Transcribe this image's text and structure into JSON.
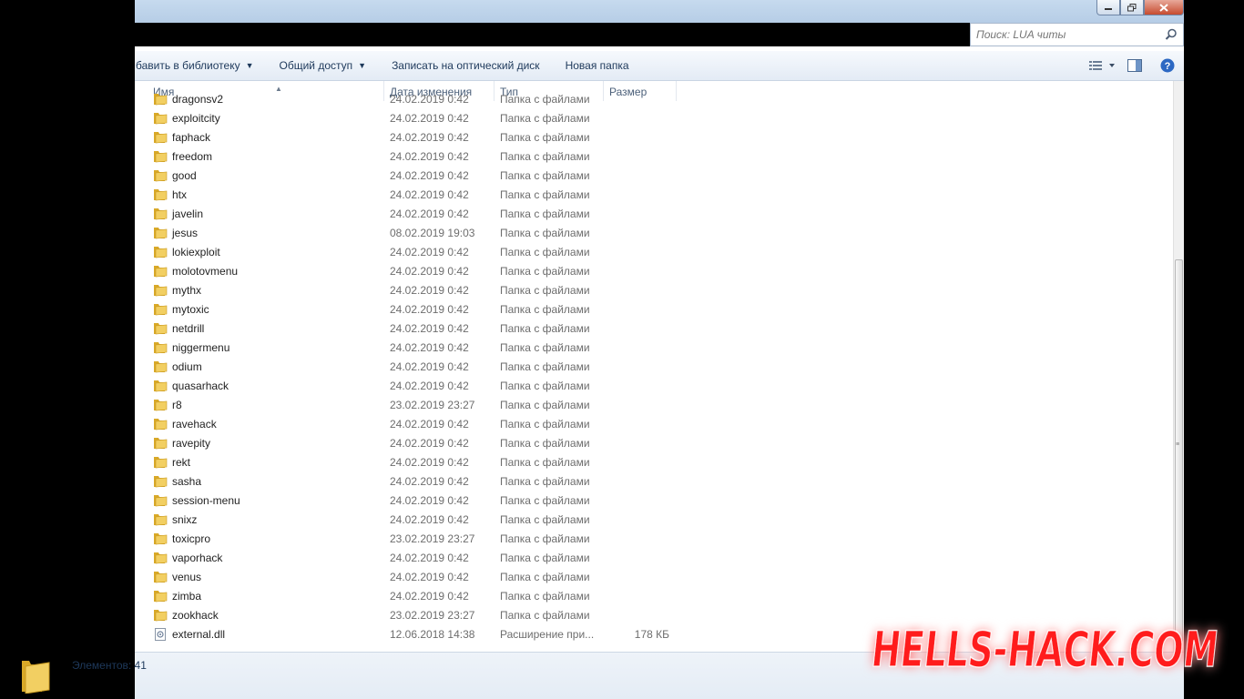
{
  "search": {
    "placeholder": "Поиск: LUA читы"
  },
  "toolbar": {
    "add_library": "бавить в библиотеку",
    "share": "Общий доступ",
    "burn": "Записать на оптический диск",
    "new_folder": "Новая папка"
  },
  "columns": {
    "name": "Имя",
    "date": "Дата изменения",
    "type": "Тип",
    "size": "Размер"
  },
  "files": [
    {
      "name": "dragonsv2",
      "date": "24.02.2019 0:42",
      "type": "Папка с файлами",
      "size": "",
      "icon": "folder-icon"
    },
    {
      "name": "exploitcity",
      "date": "24.02.2019 0:42",
      "type": "Папка с файлами",
      "size": "",
      "icon": "folder-icon"
    },
    {
      "name": "faphack",
      "date": "24.02.2019 0:42",
      "type": "Папка с файлами",
      "size": "",
      "icon": "folder-icon"
    },
    {
      "name": "freedom",
      "date": "24.02.2019 0:42",
      "type": "Папка с файлами",
      "size": "",
      "icon": "folder-icon"
    },
    {
      "name": "good",
      "date": "24.02.2019 0:42",
      "type": "Папка с файлами",
      "size": "",
      "icon": "folder-icon"
    },
    {
      "name": "htx",
      "date": "24.02.2019 0:42",
      "type": "Папка с файлами",
      "size": "",
      "icon": "folder-icon"
    },
    {
      "name": "javelin",
      "date": "24.02.2019 0:42",
      "type": "Папка с файлами",
      "size": "",
      "icon": "folder-icon"
    },
    {
      "name": "jesus",
      "date": "08.02.2019 19:03",
      "type": "Папка с файлами",
      "size": "",
      "icon": "folder-icon"
    },
    {
      "name": "lokiexploit",
      "date": "24.02.2019 0:42",
      "type": "Папка с файлами",
      "size": "",
      "icon": "folder-icon"
    },
    {
      "name": "molotovmenu",
      "date": "24.02.2019 0:42",
      "type": "Папка с файлами",
      "size": "",
      "icon": "folder-icon"
    },
    {
      "name": "mythx",
      "date": "24.02.2019 0:42",
      "type": "Папка с файлами",
      "size": "",
      "icon": "folder-icon"
    },
    {
      "name": "mytoxic",
      "date": "24.02.2019 0:42",
      "type": "Папка с файлами",
      "size": "",
      "icon": "folder-icon"
    },
    {
      "name": "netdrill",
      "date": "24.02.2019 0:42",
      "type": "Папка с файлами",
      "size": "",
      "icon": "folder-icon"
    },
    {
      "name": "niggermenu",
      "date": "24.02.2019 0:42",
      "type": "Папка с файлами",
      "size": "",
      "icon": "folder-icon"
    },
    {
      "name": "odium",
      "date": "24.02.2019 0:42",
      "type": "Папка с файлами",
      "size": "",
      "icon": "folder-icon"
    },
    {
      "name": "quasarhack",
      "date": "24.02.2019 0:42",
      "type": "Папка с файлами",
      "size": "",
      "icon": "folder-icon"
    },
    {
      "name": "r8",
      "date": "23.02.2019 23:27",
      "type": "Папка с файлами",
      "size": "",
      "icon": "folder-icon"
    },
    {
      "name": "ravehack",
      "date": "24.02.2019 0:42",
      "type": "Папка с файлами",
      "size": "",
      "icon": "folder-icon"
    },
    {
      "name": "ravepity",
      "date": "24.02.2019 0:42",
      "type": "Папка с файлами",
      "size": "",
      "icon": "folder-icon"
    },
    {
      "name": "rekt",
      "date": "24.02.2019 0:42",
      "type": "Папка с файлами",
      "size": "",
      "icon": "folder-icon"
    },
    {
      "name": "sasha",
      "date": "24.02.2019 0:42",
      "type": "Папка с файлами",
      "size": "",
      "icon": "folder-icon"
    },
    {
      "name": "session-menu",
      "date": "24.02.2019 0:42",
      "type": "Папка с файлами",
      "size": "",
      "icon": "folder-icon"
    },
    {
      "name": "snixz",
      "date": "24.02.2019 0:42",
      "type": "Папка с файлами",
      "size": "",
      "icon": "folder-icon"
    },
    {
      "name": "toxicpro",
      "date": "23.02.2019 23:27",
      "type": "Папка с файлами",
      "size": "",
      "icon": "folder-icon"
    },
    {
      "name": "vaporhack",
      "date": "24.02.2019 0:42",
      "type": "Папка с файлами",
      "size": "",
      "icon": "folder-icon"
    },
    {
      "name": "venus",
      "date": "24.02.2019 0:42",
      "type": "Папка с файлами",
      "size": "",
      "icon": "folder-icon"
    },
    {
      "name": "zimba",
      "date": "24.02.2019 0:42",
      "type": "Папка с файлами",
      "size": "",
      "icon": "folder-icon"
    },
    {
      "name": "zookhack",
      "date": "23.02.2019 23:27",
      "type": "Папка с файлами",
      "size": "",
      "icon": "folder-icon"
    },
    {
      "name": "external.dll",
      "date": "12.06.2018 14:38",
      "type": "Расширение при...",
      "size": "178 КБ",
      "icon": "dll-file-icon"
    }
  ],
  "status": {
    "items_count": "Элементов: 41"
  },
  "watermark": {
    "text": "HELLS-HACK.COM"
  },
  "colors": {
    "toolbar_text": "#1e395b",
    "folder_yellow": "#e8c14a",
    "watermark_red": "#ff1a1a"
  }
}
